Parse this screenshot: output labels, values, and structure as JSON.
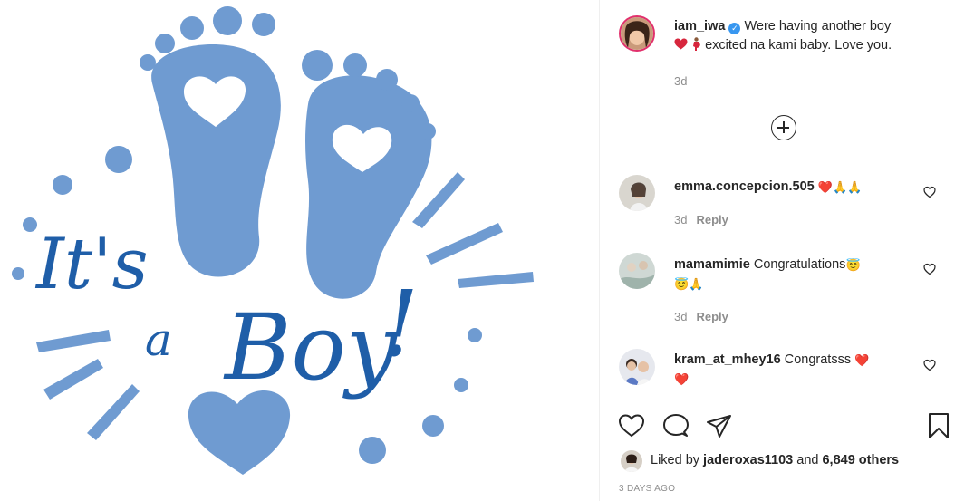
{
  "post": {
    "author": "iam_iwa",
    "caption_line1": "Were having another boy",
    "caption_line2": "excited na kami baby. Love you.",
    "caption_time": "3d",
    "verified_icon": "verified-badge-icon"
  },
  "image": {
    "text_its": "It's",
    "text_a": "a",
    "text_boy": "Boy",
    "text_exclaim": "!"
  },
  "comments": [
    {
      "user": "emma.concepcion.505",
      "text": "",
      "emojis": [
        "❤️",
        "🙏",
        "🙏"
      ],
      "time": "3d",
      "reply": "Reply"
    },
    {
      "user": "mamamimie",
      "text": "Congratulations",
      "emojis_line1": [
        "😇"
      ],
      "emojis_line2": [
        "😇",
        "🙏"
      ],
      "time": "3d",
      "reply": "Reply"
    },
    {
      "user": "kram_at_mhey16",
      "text": "Congratsss",
      "emojis_line1": [
        "❤️"
      ],
      "emojis_line2": [
        "❤️"
      ]
    }
  ],
  "footer": {
    "liked_prefix": "Liked by",
    "liked_user": "jaderoxas1103",
    "liked_and": "and",
    "liked_others": "6,849 others",
    "posted": "3 DAYS AGO"
  },
  "colors": {
    "accent_blue": "#6f9bd1",
    "text_blue": "#1f5ea8",
    "verified": "#3897f0",
    "heart_red": "#ed4956"
  }
}
